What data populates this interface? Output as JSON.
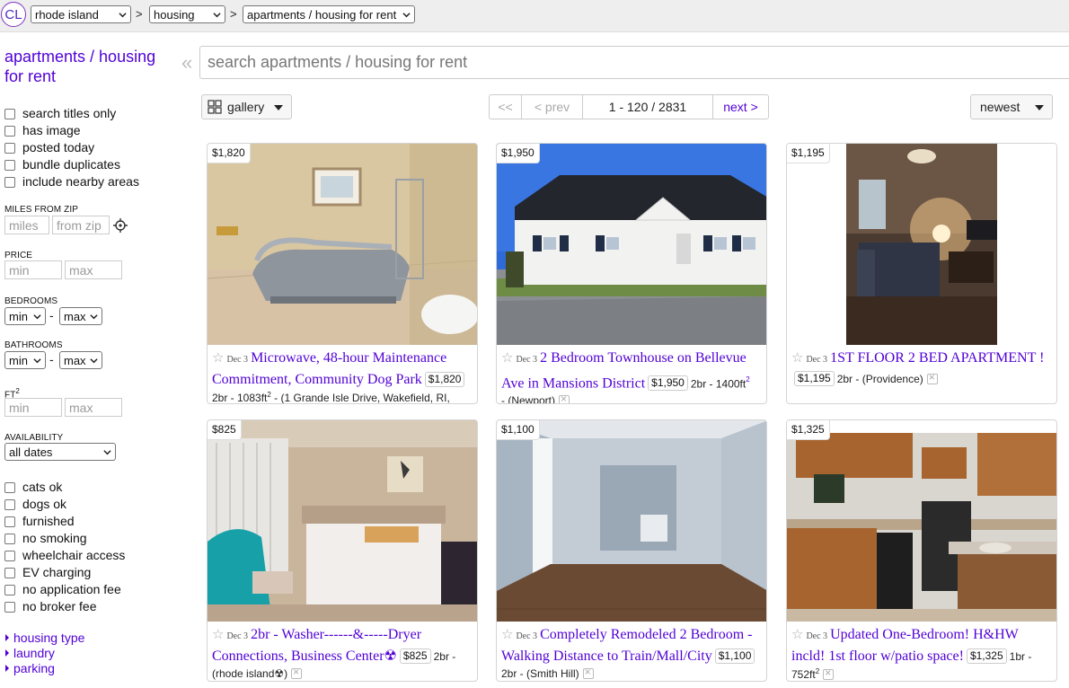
{
  "topbar": {
    "logo": "CL",
    "region": "rhode island",
    "category": "housing",
    "subcategory": "apartments / housing for rent",
    "separator": ">"
  },
  "sidebar": {
    "title": "apartments / housing for rent",
    "checkboxes_top": [
      "search titles only",
      "has image",
      "posted today",
      "bundle duplicates",
      "include nearby areas"
    ],
    "miles_label": "MILES FROM ZIP",
    "miles_placeholder": "miles",
    "zip_placeholder": "from zip",
    "price_label": "PRICE",
    "bedrooms_label": "BEDROOMS",
    "bathrooms_label": "BATHROOMS",
    "ft_label": "FT",
    "ft_sup": "2",
    "min_placeholder": "min",
    "max_placeholder": "max",
    "select_min": "min",
    "select_max": "max",
    "dash": "-",
    "availability_label": "AVAILABILITY",
    "availability_value": "all dates",
    "checkboxes_bottom": [
      "cats ok",
      "dogs ok",
      "furnished",
      "no smoking",
      "wheelchair access",
      "EV charging",
      "no application fee",
      "no broker fee"
    ],
    "links": [
      "housing type",
      "laundry",
      "parking"
    ]
  },
  "search": {
    "placeholder": "search apartments / housing for rent",
    "collapse": "«"
  },
  "toolbar": {
    "view": "gallery",
    "first": "<<",
    "prev": "< prev",
    "range": "1 - 120 / 2831",
    "next": "next >",
    "sort": "newest"
  },
  "listings": [
    {
      "price": "$1,820",
      "date": "Dec 3",
      "title": "Microwave, 48-hour Maintenance Commitment, Community Dog Park",
      "details": "2br - 1083ft",
      "sup": "2",
      "hood": " - (1 Grande Isle Drive, Wakefield, RI,",
      "image": "tanning-bed-room"
    },
    {
      "price": "$1,950",
      "date": "Dec 3",
      "title": "2 Bedroom Townhouse on Bellevue Ave in Mansions District",
      "details": "2br - 1400ft",
      "sup": "2",
      "hood": "- (Newport)",
      "image": "white-townhouse"
    },
    {
      "price": "$1,195",
      "date": "Dec 3",
      "title": "1ST FLOOR 2 BED APARTMENT !",
      "details": "2br - (Providence)",
      "sup": "",
      "hood": "",
      "image": "living-room"
    },
    {
      "price": "$825",
      "date": "Dec 3",
      "title": "2br - Washer------&-----Dryer Connections, Business Center☢",
      "details": "2br -",
      "sup": "",
      "hood": "(rhode island☢)",
      "image": "bedroom"
    },
    {
      "price": "$1,100",
      "date": "Dec 3",
      "title": "Completely Remodeled 2 Bedroom - Walking Distance to Train/Mall/City",
      "details": "",
      "sup": "",
      "hood": "2br - (Smith Hill)",
      "image": "empty-room"
    },
    {
      "price": "$1,325",
      "date": "Dec 3",
      "title": "Updated One-Bedroom! H&HW incld! 1st floor w/patio space!",
      "details": "1br -",
      "sup": "2",
      "hood": "752ft",
      "image": "kitchen"
    }
  ]
}
